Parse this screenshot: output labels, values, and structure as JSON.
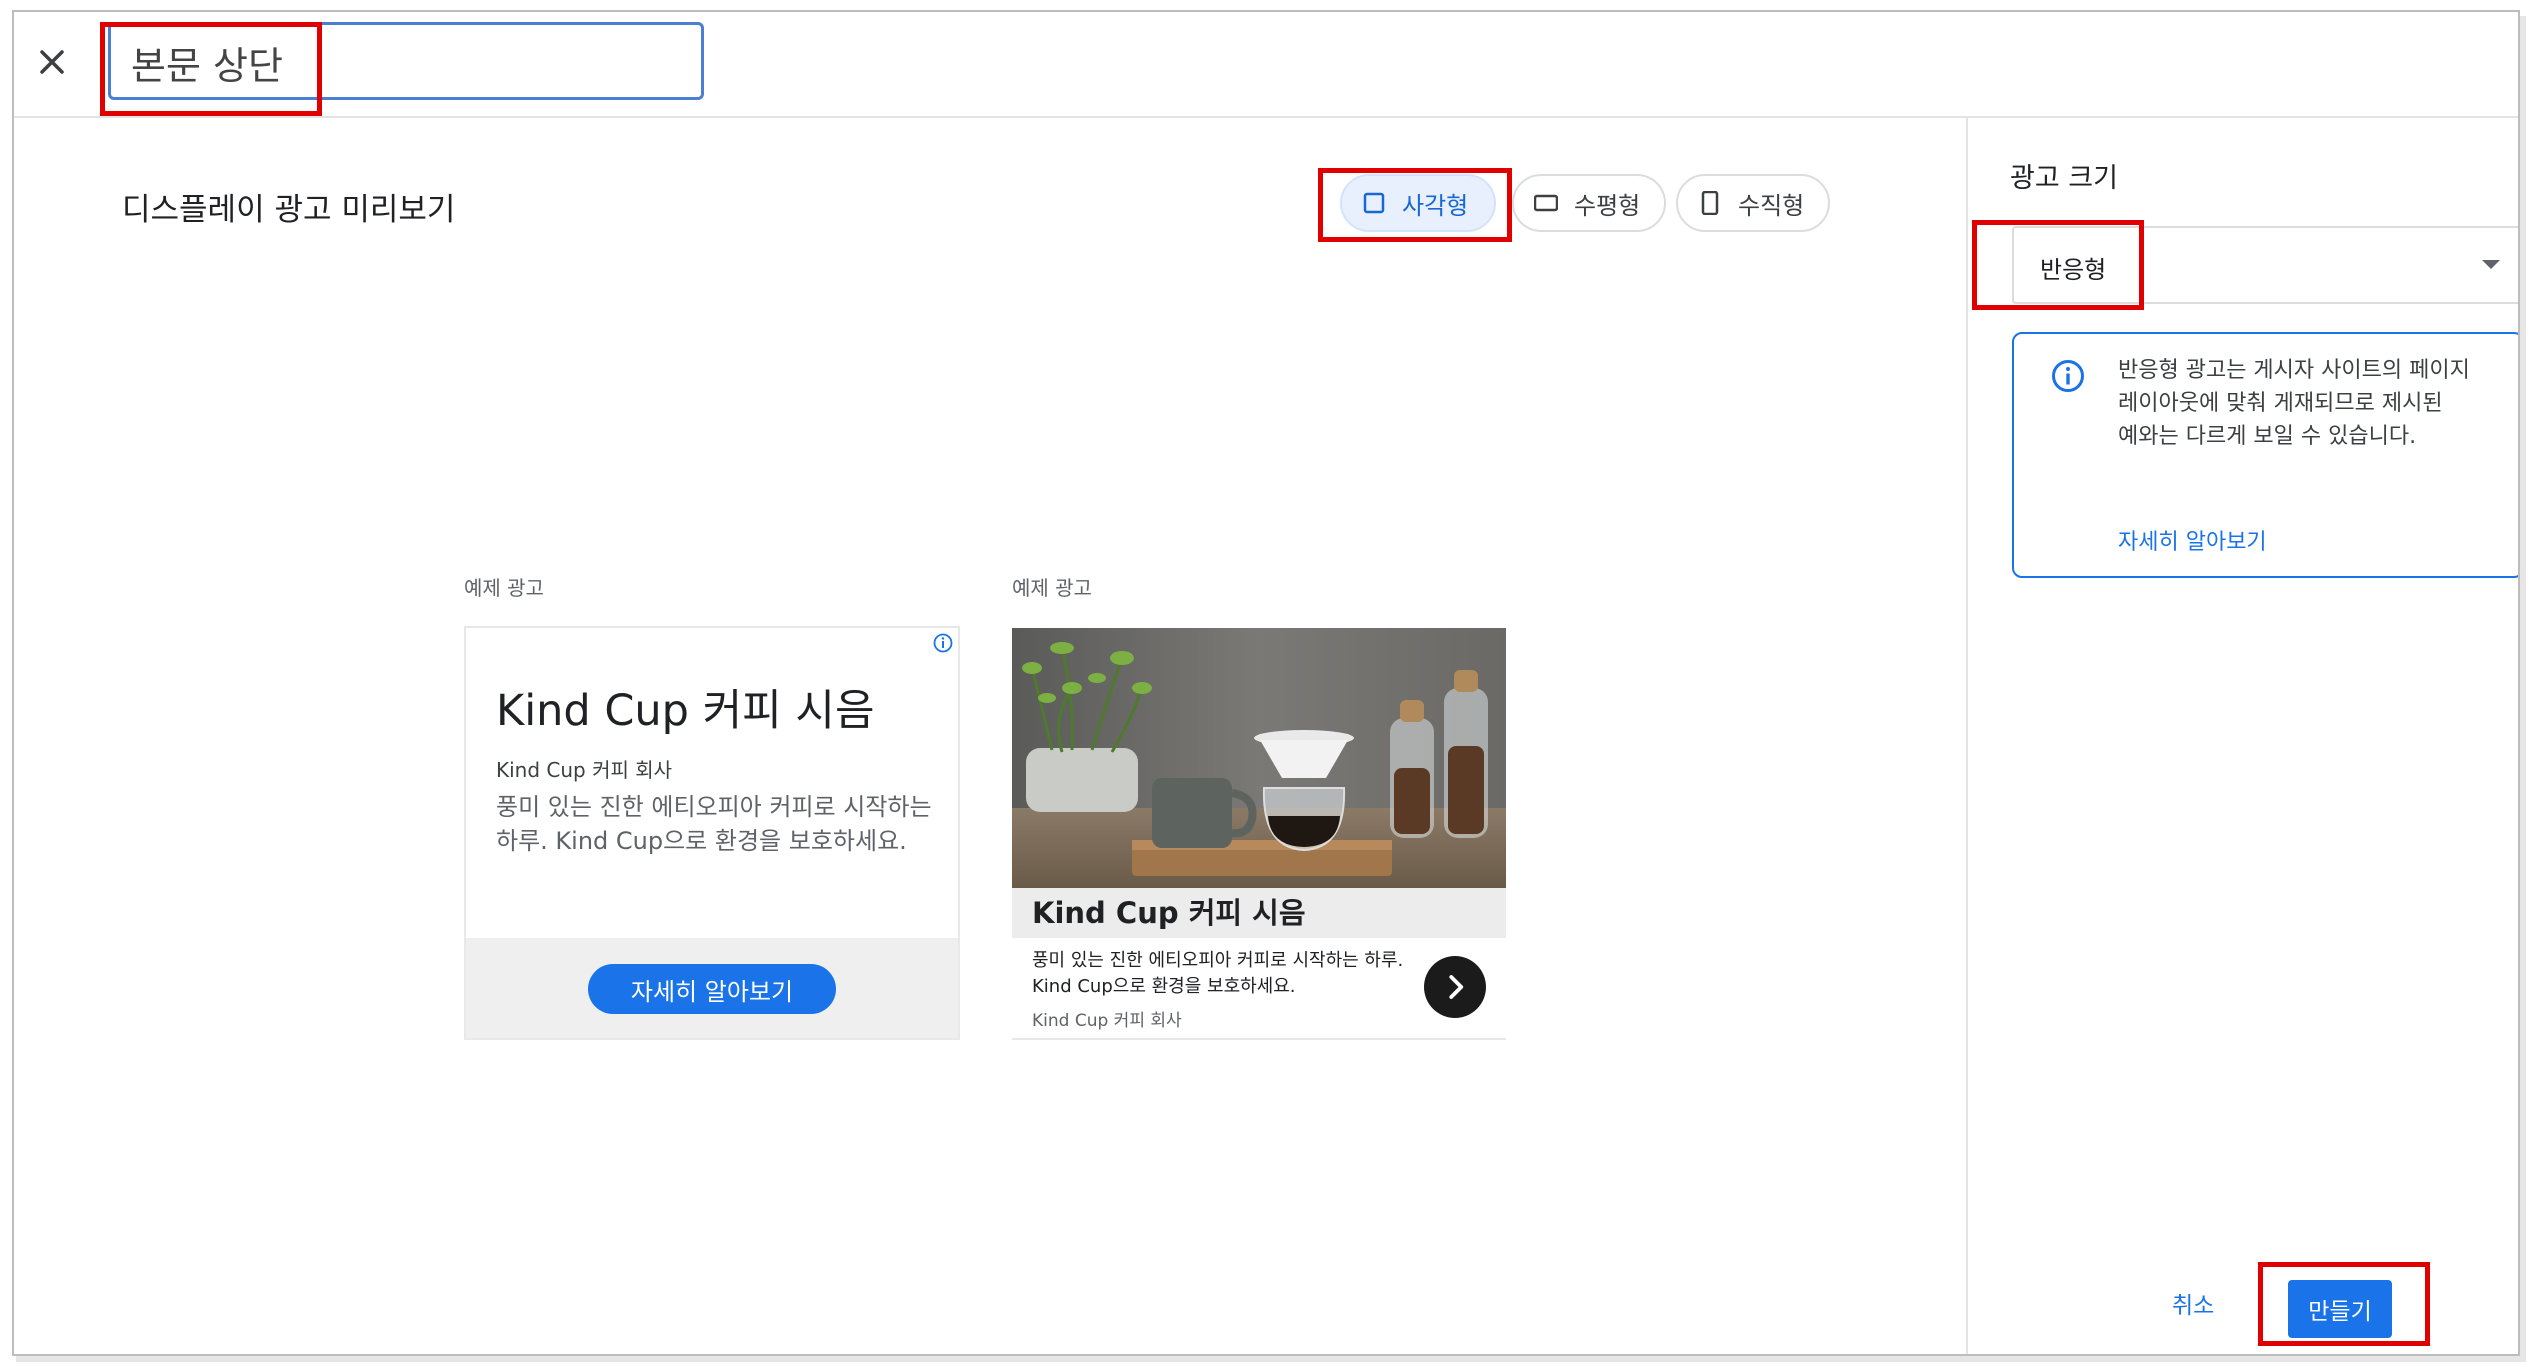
{
  "header": {
    "name_value": "본문 상단"
  },
  "preview": {
    "title": "디스플레이 광고 미리보기",
    "toggles": [
      {
        "label": "사각형",
        "icon": "square-icon",
        "active": true
      },
      {
        "label": "수평형",
        "icon": "landscape-icon",
        "active": false
      },
      {
        "label": "수직형",
        "icon": "portrait-icon",
        "active": false
      }
    ],
    "sample_label": "예제 광고",
    "card1": {
      "headline": "Kind Cup 커피 시음",
      "brand": "Kind Cup 커피 회사",
      "description": "풍미 있는 진한 에티오피아 커피로 시작하는 하루. Kind Cup으로 환경을 보호하세요.",
      "cta": "자세히 알아보기"
    },
    "card2": {
      "headline": "Kind Cup 커피 시음",
      "description": "풍미 있는 진한 에티오피아 커피로 시작하는 하루. Kind Cup으로 환경을 보호하세요.",
      "brand": "Kind Cup 커피 회사"
    }
  },
  "side": {
    "title": "광고 크기",
    "size_value": "반응형",
    "info_text": "반응형 광고는 게시자 사이트의 페이지 레이아웃에 맞춰 게재되므로 제시된 예와는 다르게 보일 수 있습니다.",
    "info_link": "자세히 알아보기"
  },
  "footer": {
    "cancel": "취소",
    "create": "만들기"
  },
  "colors": {
    "accent": "#1a73e8",
    "highlight": "#e00000"
  }
}
